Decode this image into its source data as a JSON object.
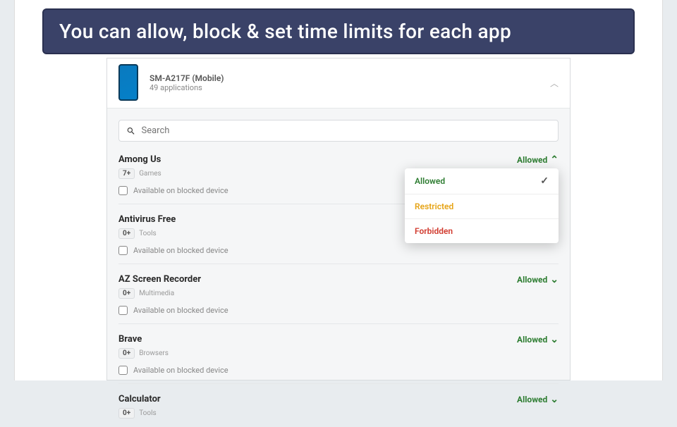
{
  "banner": "You can allow, block & set time limits for each app",
  "device": {
    "model": "SM-A217F (Mobile)",
    "count": "49 applications"
  },
  "search": {
    "placeholder": "Search"
  },
  "status_label": "Allowed",
  "checkbox_label": "Available on blocked device",
  "apps": [
    {
      "name": "Among Us",
      "age": "7+",
      "category": "Games",
      "open": true
    },
    {
      "name": "Antivirus Free",
      "age": "0+",
      "category": "Tools",
      "open": false
    },
    {
      "name": "AZ Screen Recorder",
      "age": "0+",
      "category": "Multimedia",
      "open": false
    },
    {
      "name": "Brave",
      "age": "0+",
      "category": "Browsers",
      "open": false
    },
    {
      "name": "Calculator",
      "age": "0+",
      "category": "Tools",
      "open": false
    }
  ],
  "dropdown": {
    "allowed": "Allowed",
    "restricted": "Restricted",
    "forbidden": "Forbidden"
  }
}
